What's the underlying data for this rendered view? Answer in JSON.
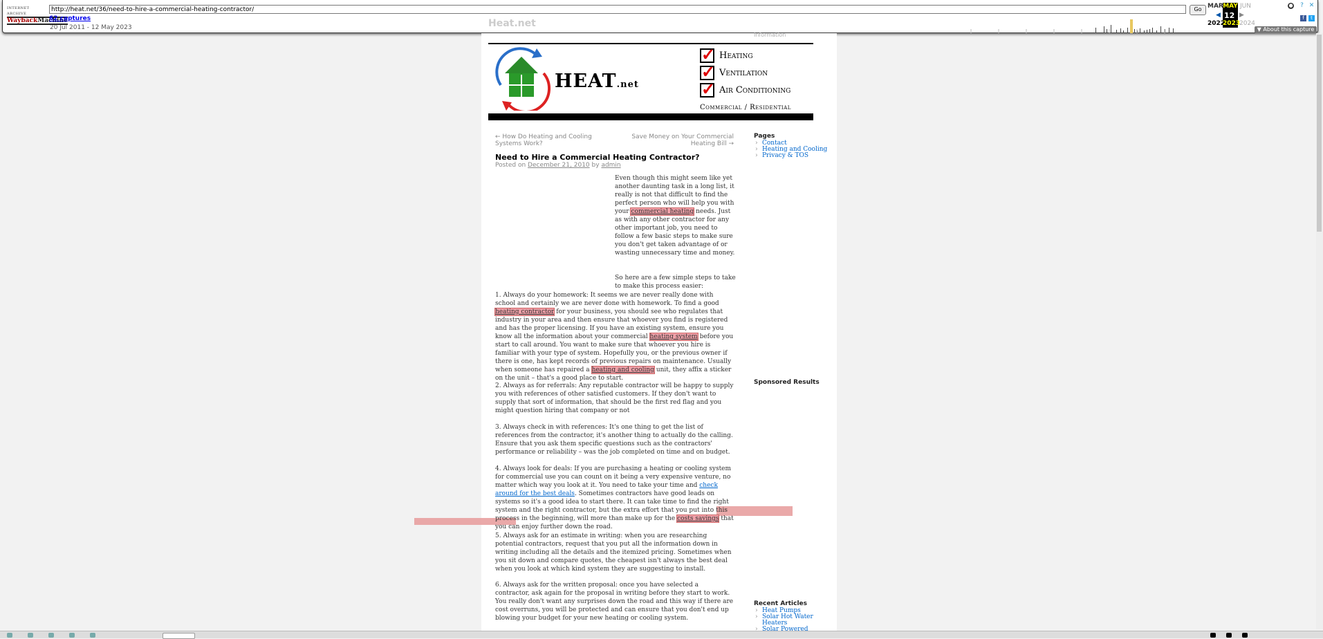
{
  "wayback": {
    "url": "http://heat.net/36/need-to-hire-a-commercial-heating-contractor/",
    "go_label": "Go",
    "captures": "62 captures",
    "range": "20 Jul 2011 - 12 May 2023",
    "cal_prev_month": "MAR",
    "cal_cur_month": "MAY",
    "cal_next_month": "JUN",
    "cal_day": "12",
    "cal_prev_year": "2022",
    "cal_cur_year": "2023",
    "cal_next_year": "2024",
    "about": "▼ About this capture"
  },
  "site": {
    "title": "Heat.net",
    "tagline": "Information",
    "logo_word": "HEAT",
    "logo_suffix": ".net",
    "services": [
      "Heating",
      "Ventilation",
      "Air Conditioning"
    ],
    "commercial": "Commercial / Residential"
  },
  "post": {
    "prev_link": "← How Do Heating and Cooling Systems Work?",
    "next_link": "Save Money on Your Commercial Heating Bill →",
    "title": "Need to Hire a Commercial Heating Contractor?",
    "posted_on": "Posted on",
    "date": "December 21, 2010",
    "by": "by",
    "author": "admin",
    "intro_a": "Even though this might seem like yet another daunting task in a long list, it really is not that difficult to find the perfect person who will help you with your",
    "intro_link": "commercial heating",
    "intro_b": "needs. Just as with any other contractor for any other important job, you need to follow a few basic steps to make sure you don't get taken advantage of or wasting unnecessary time and money.",
    "steps_intro": "So here are a few simple steps to take to make this process easier:",
    "p1_a": "1. Always do your homework: It seems we are never really done with school and certainly we are never done with homework. To find a good",
    "p1_link1": "heating contractor",
    "p1_b": "for your business, you should see who regulates that industry in your area and then ensure that whoever you find is registered and has the proper licensing. If you have an existing system, ensure you know all the information about your commercial",
    "p1_link2": "heating system",
    "p1_c": "before you start to call around. You want to make sure that whoever you hire is familiar with your type of system. Hopefully you, or the previous owner if there is one, has kept records of previous repairs on maintenance. Usually when someone has repaired a",
    "p1_link3": "heating and cooling",
    "p1_d": "unit, they affix a sticker on the unit – that's a good place to start.",
    "p2": "2. Always as for referrals: Any reputable contractor will be happy to supply you with references of other satisfied customers. If they don't want to supply that sort of information, that should be the first red flag and you might question hiring that company or not",
    "p3": "3. Always check in with references: It's one thing to get the list of references from the contractor, it's another thing to actually do the calling. Ensure that you ask them specific questions such as the contractors' performance or reliability – was the job completed on time and on budget.",
    "p4_a": "4. Always look for deals: If you are purchasing a heating or cooling system for commercial use you can count on it being a very expensive venture, no matter which way you look at it. You need to take your time and",
    "p4_link1": "check around for the best deals",
    "p4_b": ". Sometimes contractors have good leads on systems so it's a good idea to start there. It can take time to find the right system and the right contractor, but the extra effort that you put into this process in the beginning, will more than make up for the",
    "p4_link2": "costs savings",
    "p4_c": "that you can enjoy further down the road.",
    "p5": "5. Always ask for an estimate in writing: when you are researching potential contractors, request that you put all the information down in writing including all the details and the itemized pricing. Sometimes when you sit down and compare quotes, the cheapest isn't always the best deal when you look at which kind system they are suggesting to install.",
    "p6": "6. Always ask for the written proposal: once you have selected a contractor, ask again for the proposal in writing before they start to work. You really don't want any surprises down the road and this way if there are cost overruns, you will be protected and can ensure that you don't end up blowing your budget for your new heating or cooling system."
  },
  "sidebar": {
    "pages_title": "Pages",
    "pages": [
      "Contact",
      "Heating and Cooling",
      "Privacy & TOS"
    ],
    "sponsored_title": "Sponsored Results",
    "recent_title": "Recent Articles",
    "recent": [
      "Heat Pumps",
      "Solar Hot Water Heaters",
      "Solar Powered Air"
    ]
  },
  "colors": {
    "link": "#0066cc",
    "highlight": "#f0a0a8",
    "calendar_active": "#ffff00"
  }
}
